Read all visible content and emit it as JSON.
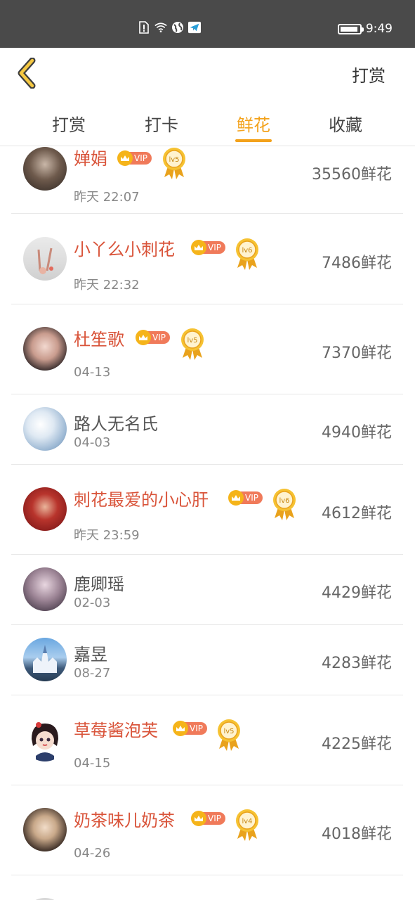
{
  "status_bar": {
    "time": "9:49"
  },
  "header": {
    "back_icon": "chevron-left-icon",
    "action_label": "打赏"
  },
  "tabs": [
    {
      "label": "打赏",
      "active": false
    },
    {
      "label": "打卡",
      "active": false
    },
    {
      "label": "鲜花",
      "active": true
    },
    {
      "label": "收藏",
      "active": false
    }
  ],
  "accent_color": "#f3a21b",
  "vip_name_color": "#d9543a",
  "rows": [
    {
      "name": "婵娟",
      "date": "昨天 22:07",
      "count": "35560鲜花",
      "vip": true,
      "vip_label": "VIP",
      "level": "lv5"
    },
    {
      "name": "小丫么小刺花",
      "date": "昨天 22:32",
      "count": "7486鲜花",
      "vip": true,
      "vip_label": "VIP",
      "level": "lv6"
    },
    {
      "name": "杜笙歌",
      "date": "04-13",
      "count": "7370鲜花",
      "vip": true,
      "vip_label": "VIP",
      "level": "lv5"
    },
    {
      "name": "路人无名氏",
      "date": "04-03",
      "count": "4940鲜花",
      "vip": false
    },
    {
      "name": "刺花最爱的小心肝",
      "date": "昨天 23:59",
      "count": "4612鲜花",
      "vip": true,
      "vip_label": "VIP",
      "level": "lv6"
    },
    {
      "name": "鹿卿瑶",
      "date": "02-03",
      "count": "4429鲜花",
      "vip": false
    },
    {
      "name": "嘉昱",
      "date": "08-27",
      "count": "4283鲜花",
      "vip": false
    },
    {
      "name": "草莓酱泡芙",
      "date": "04-15",
      "count": "4225鲜花",
      "vip": true,
      "vip_label": "VIP",
      "level": "lv5"
    },
    {
      "name": "奶茶味儿奶茶",
      "date": "04-26",
      "count": "4018鲜花",
      "vip": true,
      "vip_label": "VIP",
      "level": "lv4"
    }
  ]
}
